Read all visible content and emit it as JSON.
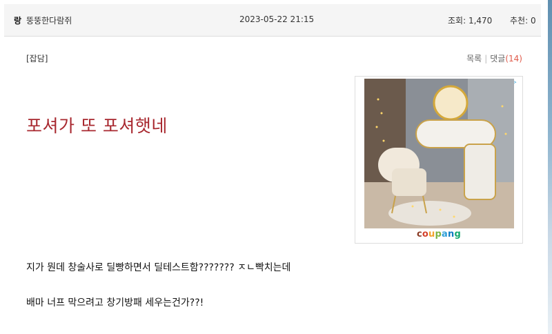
{
  "header": {
    "author_icon": "랑",
    "author": "뚱뚱한다람쥐",
    "date": "2023-05-22 21:15",
    "views": "조회: 1,470",
    "recommends": "추천: 0"
  },
  "post": {
    "category": "[잡담]",
    "list_link": "목록",
    "comments_label": "댓글",
    "comments_count": "(14)",
    "title": "포셔가 또 포셔햇네",
    "lines": [
      "지가 뭔데 창술사로 딜빵하면서 딜테스트함??????? ㅈㄴ빡치는데",
      "배마 너프 막으려고 창기방패 세우는건가??!"
    ]
  },
  "ad": {
    "logo_letters": [
      "c",
      "o",
      "u",
      "p",
      "a",
      "n",
      "g"
    ],
    "logo_colors": [
      "#8a3b25",
      "#d4412c",
      "#f2a22a",
      "#7cb342",
      "#2e9fd8",
      "#0f7dc2",
      "#13a96f"
    ],
    "badge_icon": "adchoices-icon"
  }
}
